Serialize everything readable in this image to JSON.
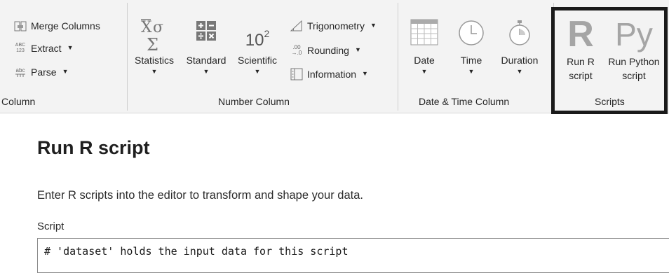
{
  "ribbon": {
    "column_group": {
      "label": "Column",
      "merge_columns": "Merge Columns",
      "extract": "Extract",
      "extract_icon_text": "ABC\n123",
      "parse": "Parse",
      "parse_icon_text": "abc"
    },
    "number_group": {
      "label": "Number Column",
      "statistics": "Statistics",
      "standard": "Standard",
      "scientific": "Scientific",
      "scientific_icon_base": "10",
      "scientific_icon_exp": "2",
      "trigonometry": "Trigonometry",
      "rounding": "Rounding",
      "rounding_icon_text": ".00\n→.0",
      "information": "Information"
    },
    "datetime_group": {
      "label": "Date & Time Column",
      "date": "Date",
      "time": "Time",
      "duration": "Duration"
    },
    "scripts_group": {
      "label": "Scripts",
      "run_r_line1": "Run R",
      "run_r_line2": "script",
      "run_r_icon": "R",
      "run_python_line1": "Run Python",
      "run_python_line2": "script",
      "run_python_icon": "Py"
    }
  },
  "dialog": {
    "title": "Run R script",
    "description": "Enter R scripts into the editor to transform and shape your data.",
    "script_label": "Script",
    "editor_line": "# 'dataset' holds the input data for this script"
  }
}
